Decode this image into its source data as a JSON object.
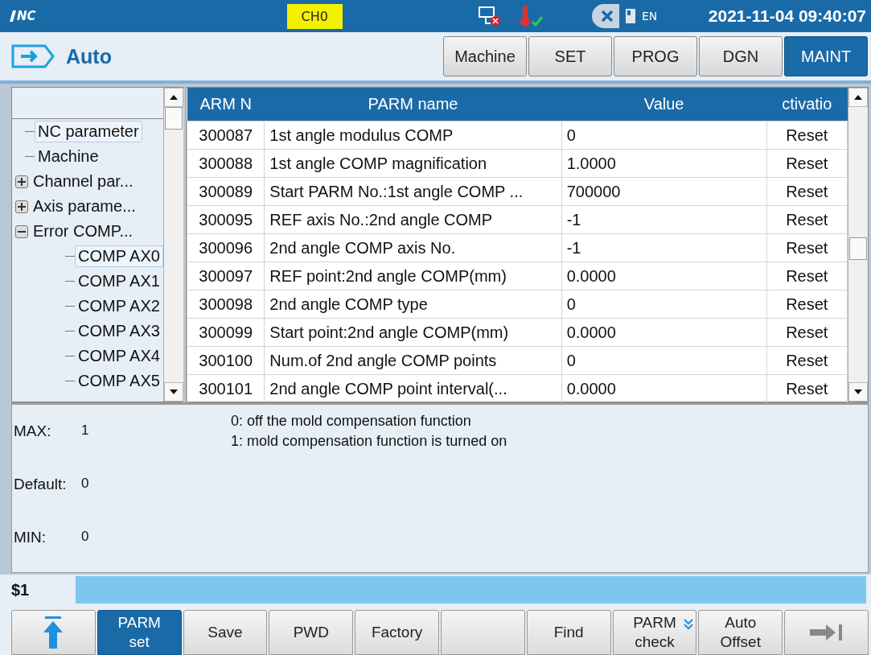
{
  "header": {
    "logo_text": "NC",
    "channel": "CH0",
    "language": "EN",
    "datetime": "2021-11-04 09:40:07"
  },
  "mode": {
    "label": "Auto"
  },
  "tabs": [
    {
      "label": "Machine",
      "selected": false
    },
    {
      "label": "SET",
      "selected": false
    },
    {
      "label": "PROG",
      "selected": false
    },
    {
      "label": "DGN",
      "selected": false
    },
    {
      "label": "MAINT",
      "selected": true
    }
  ],
  "tree": [
    {
      "label": "NC parameter",
      "selected": true
    },
    {
      "label": "Machine",
      "selected": false
    },
    {
      "label": "Channel par...",
      "selected": false,
      "expanded": false
    },
    {
      "label": "Axis parame...",
      "selected": false,
      "expanded": false
    },
    {
      "label": "Error COMP...",
      "selected": false,
      "expanded": true,
      "children": [
        {
          "label": "COMP AX0",
          "selected": true
        },
        {
          "label": "COMP AX1",
          "selected": false
        },
        {
          "label": "COMP AX2",
          "selected": false
        },
        {
          "label": "COMP AX3",
          "selected": false
        },
        {
          "label": "COMP AX4",
          "selected": false
        },
        {
          "label": "COMP AX5",
          "selected": false
        }
      ]
    }
  ],
  "table": {
    "columns": [
      "ARM N",
      "PARM name",
      "Value",
      "ctivatio"
    ],
    "rows": [
      [
        "300087",
        "1st angle modulus COMP",
        "0",
        "Reset"
      ],
      [
        "300088",
        "1st angle COMP magnification",
        "1.0000",
        "Reset"
      ],
      [
        "300089",
        "Start PARM No.:1st angle COMP ...",
        "700000",
        "Reset"
      ],
      [
        "300095",
        "REF axis No.:2nd angle COMP",
        "-1",
        "Reset"
      ],
      [
        "300096",
        "2nd angle COMP axis No.",
        "-1",
        "Reset"
      ],
      [
        "300097",
        "REF point:2nd angle COMP(mm)",
        "0.0000",
        "Reset"
      ],
      [
        "300098",
        "2nd angle COMP type",
        "0",
        "Reset"
      ],
      [
        "300099",
        "Start point:2nd angle COMP(mm)",
        "0.0000",
        "Reset"
      ],
      [
        "300100",
        "Num.of 2nd angle COMP points",
        "0",
        "Reset"
      ],
      [
        "300101",
        "2nd angle COMP point interval(...",
        "0.0000",
        "Reset"
      ]
    ]
  },
  "info": {
    "limits": [
      {
        "label": "MAX:",
        "value": "1"
      },
      {
        "label": "Default:",
        "value": "0"
      },
      {
        "label": "MIN:",
        "value": "0"
      }
    ],
    "description": [
      "0: off the mold compensation function",
      "1: mold compensation function is turned on"
    ]
  },
  "command": {
    "prompt": "$1"
  },
  "softkeys": [
    {
      "kind": "top",
      "selected": false
    },
    {
      "kind": "text",
      "label": "PARM\nset",
      "selected": true
    },
    {
      "kind": "text",
      "label": "Save",
      "selected": false
    },
    {
      "kind": "text",
      "label": "PWD",
      "selected": false
    },
    {
      "kind": "text",
      "label": "Factory",
      "selected": false
    },
    {
      "kind": "blank",
      "selected": false
    },
    {
      "kind": "text",
      "label": "Find",
      "selected": false
    },
    {
      "kind": "menu",
      "label": "PARM\ncheck",
      "selected": false
    },
    {
      "kind": "text",
      "label": "Auto\nOffset",
      "selected": false
    },
    {
      "kind": "end",
      "selected": false
    }
  ]
}
